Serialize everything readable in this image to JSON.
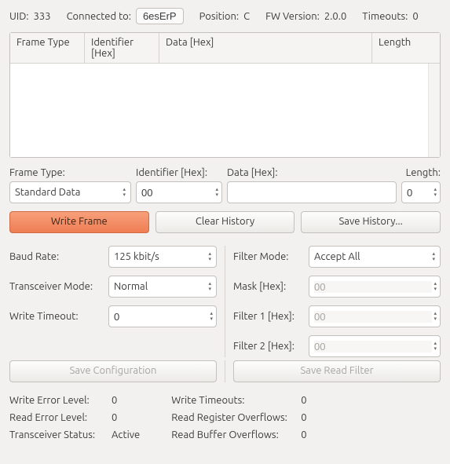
{
  "top": {
    "uid_label": "UID:",
    "uid_value": "333",
    "connected_label": "Connected to:",
    "connected_value": "6esErP",
    "position_label": "Position:",
    "position_value": "C",
    "fw_label": "FW Version:",
    "fw_value": "2.0.0",
    "timeouts_label": "Timeouts:",
    "timeouts_value": "0"
  },
  "table": {
    "headers": {
      "frame": "Frame Type",
      "ident": "Identifier [Hex]",
      "data": "Data [Hex]",
      "len": "Length"
    }
  },
  "input_labels": {
    "frame": "Frame Type:",
    "ident": "Identifier [Hex]:",
    "data": "Data [Hex]:",
    "len": "Length:"
  },
  "inputs": {
    "frame": "Standard Data",
    "ident": "00",
    "data": "",
    "len": "0"
  },
  "buttons": {
    "write_frame": "Write Frame",
    "clear_history": "Clear History",
    "save_history": "Save History..."
  },
  "cfg_left": {
    "baud_label": "Baud Rate:",
    "baud_value": "125 kbit/s",
    "mode_label": "Transceiver Mode:",
    "mode_value": "Normal",
    "timeout_label": "Write Timeout:",
    "timeout_value": "0"
  },
  "cfg_right": {
    "filter_mode_label": "Filter Mode:",
    "filter_mode_value": "Accept All",
    "mask_label": "Mask [Hex]:",
    "mask_value": "00",
    "f1_label": "Filter 1 [Hex]:",
    "f1_value": "00",
    "f2_label": "Filter 2 [Hex]:",
    "f2_value": "00"
  },
  "save_buttons": {
    "save_config": "Save Configuration",
    "save_filter": "Save Read Filter"
  },
  "stats_left": {
    "wel_label": "Write Error Level:",
    "wel_value": "0",
    "rel_label": "Read Error Level:",
    "rel_value": "0",
    "ts_label": "Transceiver Status:",
    "ts_value": "Active"
  },
  "stats_right": {
    "wt_label": "Write Timeouts:",
    "wt_value": "0",
    "rro_label": "Read Register Overflows:",
    "rro_value": "0",
    "rbo_label": "Read Buffer Overflows:",
    "rbo_value": "0"
  }
}
